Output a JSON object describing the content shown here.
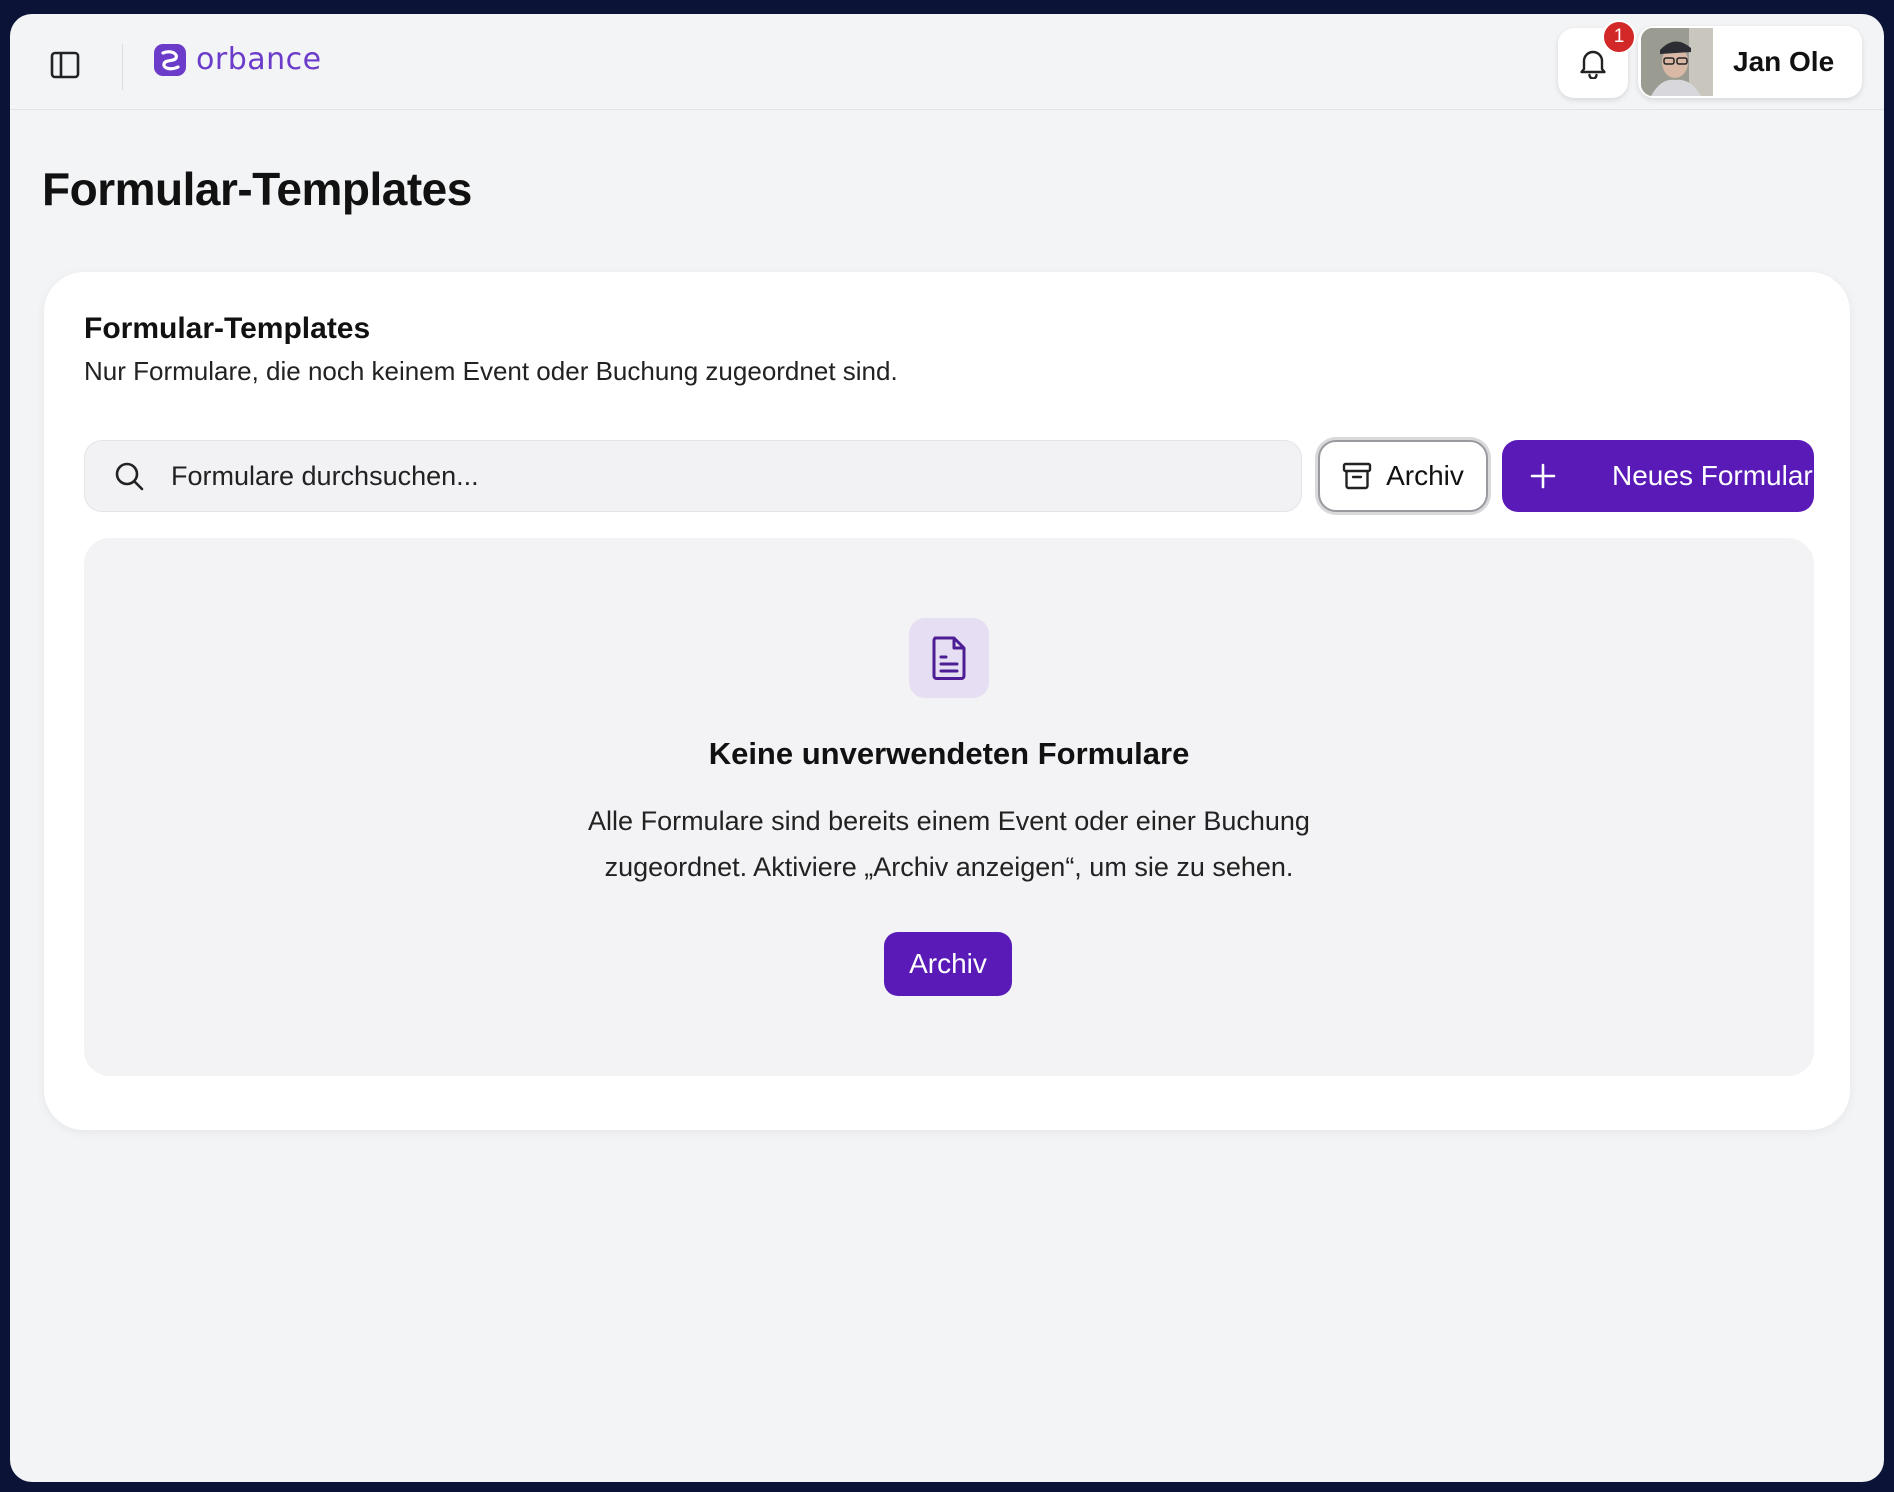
{
  "brand": {
    "name": "orbance",
    "color": "#6b3cc9"
  },
  "header": {
    "notifications": {
      "count": "1",
      "icon": "bell-icon"
    },
    "user": {
      "name": "Jan Ole"
    }
  },
  "page": {
    "title": "Formular-Templates"
  },
  "card": {
    "title": "Formular-Templates",
    "subtitle": "Nur Formulare, die noch keinem Event oder Buchung zugeordnet sind."
  },
  "toolbar": {
    "search_placeholder": "Formulare durchsuchen...",
    "archive_label": "Archiv",
    "new_form_label": "Neues Formular"
  },
  "empty_state": {
    "icon": "document-icon",
    "title": "Keine unverwendeten Formulare",
    "text": "Alle Formulare sind bereits einem Event oder einer Buchung zugeordnet. Aktiviere „Archiv anzeigen“, um sie zu sehen.",
    "button_label": "Archiv"
  },
  "colors": {
    "accent": "#5a1ab8",
    "badge": "#d22828",
    "background": "#f3f4f6"
  }
}
